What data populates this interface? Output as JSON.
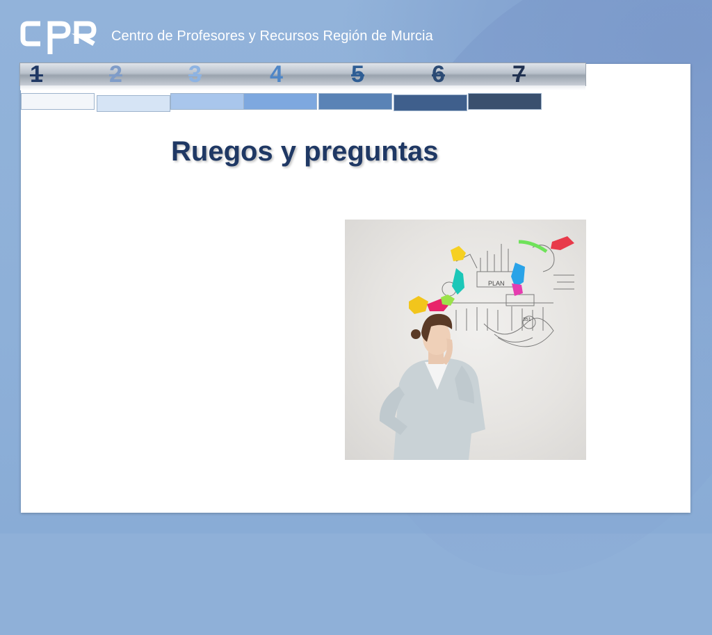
{
  "header": {
    "logo_text": "CPR",
    "org_name": "Centro de Profesores y Recursos Región de Murcia"
  },
  "progress": {
    "steps": [
      {
        "label": "1",
        "color": "#1f3864"
      },
      {
        "label": "2",
        "color": "#7f9cc8"
      },
      {
        "label": "3",
        "color": "#8db3e2"
      },
      {
        "label": "4",
        "color": "#4f86c6"
      },
      {
        "label": "5",
        "color": "#2e5d94"
      },
      {
        "label": "6",
        "color": "#2b4a74"
      },
      {
        "label": "7",
        "color": "#1f3050"
      }
    ],
    "block_colors": [
      "#f3f6fa",
      "#d6e4f5",
      "#a9c6ec",
      "#7ea8df",
      "#5a83b6",
      "#3f5f8c",
      "#3a506e"
    ]
  },
  "slide": {
    "title": "Ruegos y preguntas"
  },
  "colors": {
    "background": "#8fb0d8",
    "title": "#1f3864"
  }
}
